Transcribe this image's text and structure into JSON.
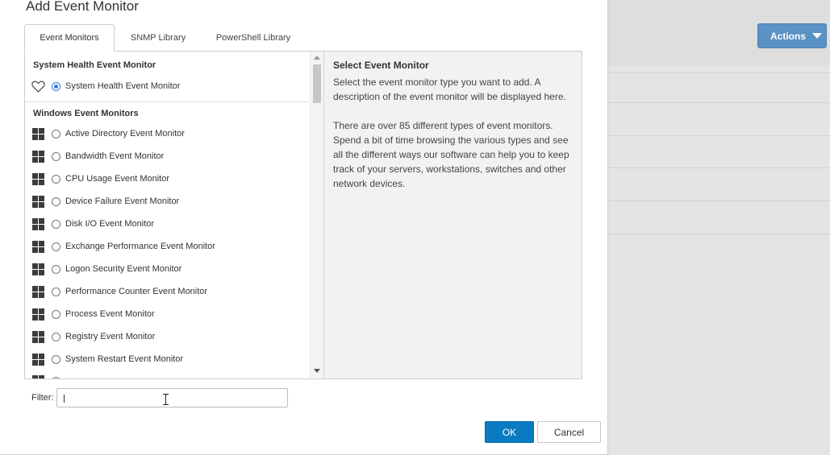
{
  "dialog": {
    "title": "Add Event Monitor",
    "tabs": [
      {
        "label": "Event Monitors",
        "active": true
      },
      {
        "label": "SNMP Library",
        "active": false
      },
      {
        "label": "PowerShell Library",
        "active": false
      }
    ],
    "groups": [
      {
        "heading": "System Health Event Monitor",
        "items": [
          {
            "label": "System Health Event Monitor",
            "icon": "heart-icon",
            "selected": true
          }
        ]
      },
      {
        "heading": "Windows Event Monitors",
        "items": [
          {
            "label": "Active Directory Event Monitor",
            "icon": "windows-icon"
          },
          {
            "label": "Bandwidth Event Monitor",
            "icon": "windows-icon"
          },
          {
            "label": "CPU Usage Event Monitor",
            "icon": "windows-icon"
          },
          {
            "label": "Device Failure Event Monitor",
            "icon": "windows-icon"
          },
          {
            "label": "Disk I/O Event Monitor",
            "icon": "windows-icon"
          },
          {
            "label": "Exchange Performance Event Monitor",
            "icon": "windows-icon"
          },
          {
            "label": "Logon Security Event Monitor",
            "icon": "windows-icon"
          },
          {
            "label": "Performance Counter Event Monitor",
            "icon": "windows-icon"
          },
          {
            "label": "Process Event Monitor",
            "icon": "windows-icon"
          },
          {
            "label": "Registry Event Monitor",
            "icon": "windows-icon"
          },
          {
            "label": "System Restart Event Monitor",
            "icon": "windows-icon"
          }
        ]
      }
    ],
    "description": {
      "title": "Select Event Monitor",
      "paragraph1": "Select the event monitor type you want to add. A description of the event monitor will be displayed here.",
      "paragraph2": "There are over 85 different types of event monitors. Spend a bit of time browsing the various types and see all the different ways our software can help you to keep track of your servers, workstations, switches and other network devices."
    },
    "filter": {
      "label": "Filter:",
      "value": ""
    },
    "ok_label": "OK",
    "cancel_label": "Cancel"
  },
  "background": {
    "actions_label": "Actions"
  },
  "colors": {
    "primary_button": "#0a7bc2",
    "actions_button": "#5b92c4",
    "radio_selected": "#2a7bd4"
  }
}
